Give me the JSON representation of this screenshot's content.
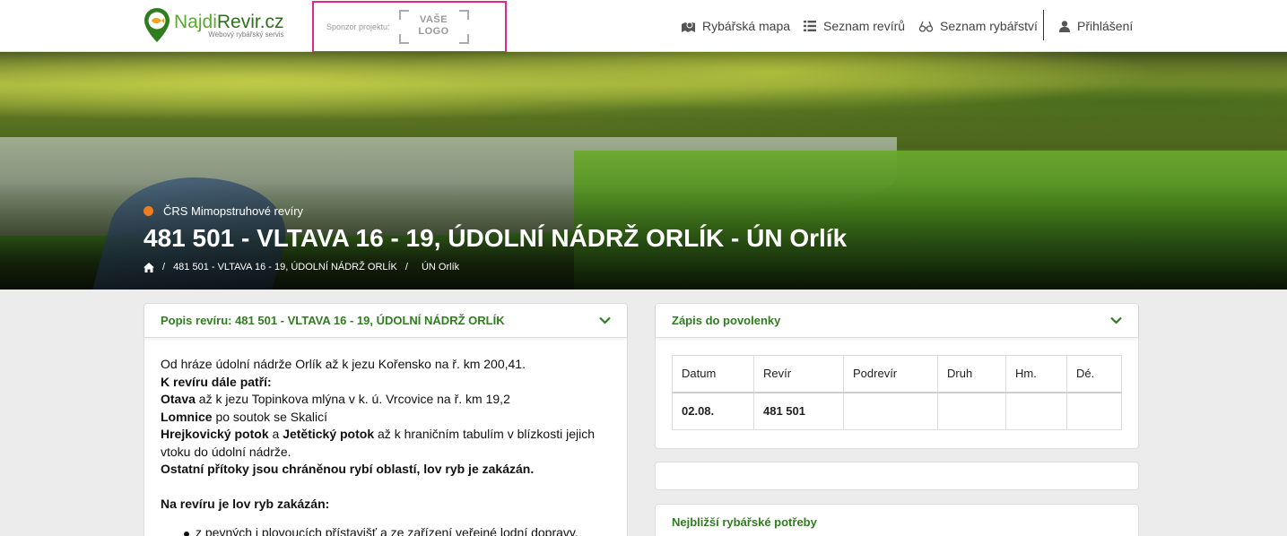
{
  "header": {
    "logo": {
      "name_light": "Najdi",
      "name_bold": "Revir.cz",
      "tagline": "Webový rybářský servis"
    },
    "sponsor": {
      "label": "Sponzor projektu:",
      "logo_line1": "VAŠE",
      "logo_line2": "LOGO"
    },
    "nav": [
      {
        "label": "Rybářská mapa",
        "icon": "map-icon"
      },
      {
        "label": "Seznam revírů",
        "icon": "list-icon"
      },
      {
        "label": "Seznam rybářství",
        "icon": "binoculars-icon"
      },
      {
        "label": "Přihlášení",
        "icon": "user-icon"
      }
    ]
  },
  "hero": {
    "category": "ČRS Mimopstruhové revíry",
    "category_color": "#f07c1e",
    "title": "481 501 - VLTAVA 16 - 19, ÚDOLNÍ NÁDRŽ ORLÍK - ÚN Orlík",
    "breadcrumb": [
      "481 501 - VLTAVA 16 - 19, ÚDOLNÍ NÁDRŽ ORLÍK",
      "ÚN Orlík"
    ]
  },
  "description_panel": {
    "title": "Popis revíru: 481 501 - VLTAVA 16 - 19, ÚDOLNÍ NÁDRŽ ORLÍK",
    "line1": "Od hráze údolní nádrže Orlík až k jezu Kořensko na ř. km 200,41.",
    "also_heading": "K revíru dále patří:",
    "otava_name": "Otava",
    "otava_text": " až k jezu Topinkova mlýna v k. ú. Vrcovice na ř. km 19,2",
    "lomnice_name": "Lomnice",
    "lomnice_text": " po soutok se Skalicí",
    "hrej_name": "Hrejkovický potok",
    "and_text": " a ",
    "jet_name": "Jetětický potok",
    "hrej_text": " až k hraničním tabulím v blízkosti jejich vtoku do údolní nádrže.",
    "tributaries": "Ostatní přítoky jsou chráněnou rybí oblastí, lov ryb je zakázán.",
    "forbidden_heading": "Na revíru je lov ryb zakázán:",
    "forbidden_items": [
      "z pevných i plovoucích přístavišť a ze zařízení veřejné lodní dopravy,"
    ]
  },
  "permit_panel": {
    "title": "Zápis do povolenky",
    "columns": [
      "Datum",
      "Revír",
      "Podrevír",
      "Druh",
      "Hm.",
      "Dé."
    ],
    "rows": [
      [
        "02.08.",
        "481 501",
        "",
        "",
        "",
        ""
      ]
    ]
  },
  "nearby_panel": {
    "title": "Nejbližší rybářské potřeby"
  },
  "colors": {
    "accent_green": "#2f7d1f",
    "sponsor_border": "#e0288a"
  }
}
